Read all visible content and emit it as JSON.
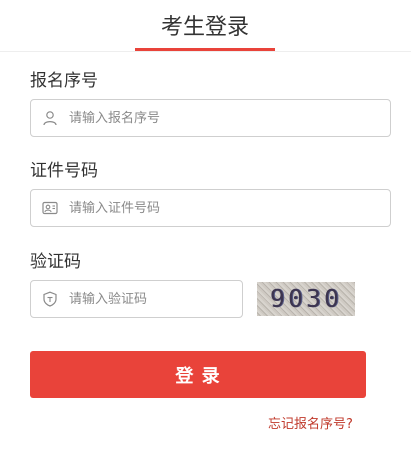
{
  "header": {
    "title": "考生登录"
  },
  "form": {
    "registration_number": {
      "label": "报名序号",
      "placeholder": "请输入报名序号",
      "value": "",
      "icon": "user-icon"
    },
    "id_number": {
      "label": "证件号码",
      "placeholder": "请输入证件号码",
      "value": "",
      "icon": "id-card-icon"
    },
    "captcha": {
      "label": "验证码",
      "placeholder": "请输入验证码",
      "value": "",
      "icon": "shield-icon",
      "image_text": "9030"
    },
    "login_label": "登  录",
    "forgot_link": "忘记报名序号?"
  },
  "colors": {
    "accent": "#e9433a",
    "link": "#c0392b"
  }
}
